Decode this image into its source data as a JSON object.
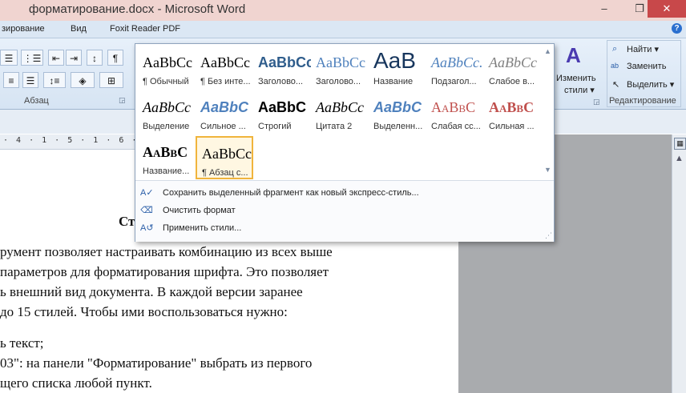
{
  "window": {
    "title": "форматирование.docx - Microsoft Word",
    "minimize_glyph": "–",
    "maximize_glyph": "❐",
    "close_glyph": "✕"
  },
  "ribbon_tabs": [
    "зирование",
    "Вид",
    "Foxit Reader PDF"
  ],
  "help_glyph": "?",
  "paragraph_group": {
    "label": "Абзац"
  },
  "styles_group": {
    "change_styles_label_1": "Изменить",
    "change_styles_label_2": "стили ▾"
  },
  "editing_group": {
    "label": "Редактирование",
    "items": [
      "Найти ▾",
      "Заменить",
      "Выделить ▾"
    ]
  },
  "ruler": {
    "numbers": "· 4 · 1 · 5 · 1 · 6 · 1 · 7 · 1 · 8 · 1 · 9 · 1 · 10"
  },
  "gallery": {
    "tiles": [
      {
        "sample": "AaBbCс",
        "name": "¶ Обычный",
        "color": "#000000",
        "style": "normal"
      },
      {
        "sample": "AaBbCс",
        "name": "¶ Без инте...",
        "color": "#000000",
        "style": "normal"
      },
      {
        "sample": "AaBbCс",
        "name": "Заголово...",
        "color": "#2f5d8c",
        "style": "bold"
      },
      {
        "sample": "AaBbCс",
        "name": "Заголово...",
        "color": "#4f81bd",
        "style": "normal"
      },
      {
        "sample": "AaB",
        "name": "Название",
        "color": "#17365d",
        "style": "big"
      },
      {
        "sample": "AaBbCc.",
        "name": "Подзагол...",
        "color": "#4f81bd",
        "style": "italic"
      },
      {
        "sample": "AaBbCс",
        "name": "Слабое в...",
        "color": "#808080",
        "style": "italic"
      },
      {
        "sample": "AaBbCс",
        "name": "Выделение",
        "color": "#000000",
        "style": "italic"
      },
      {
        "sample": "AaBbC",
        "name": "Сильное ...",
        "color": "#4f81bd",
        "style": "bolditalic"
      },
      {
        "sample": "AaBbC",
        "name": "Строгий",
        "color": "#000000",
        "style": "bold"
      },
      {
        "sample": "AaBbCс",
        "name": "Цитата 2",
        "color": "#000000",
        "style": "italic"
      },
      {
        "sample": "AaBbC",
        "name": "Выделенн...",
        "color": "#4f81bd",
        "style": "bolditalic"
      },
      {
        "sample": "AaBbC",
        "name": "Слабая сс...",
        "color": "#c0504d",
        "style": "smallcaps"
      },
      {
        "sample": "AaBbC",
        "name": "Сильная ...",
        "color": "#c0504d",
        "style": "boldsmallcaps"
      },
      {
        "sample": "AaBbC",
        "name": "Название...",
        "color": "#000000",
        "style": "boldsmallcaps"
      },
      {
        "sample": "AaBbCс",
        "name": "¶ Абзац с...",
        "color": "#000000",
        "style": "normal",
        "selected": true
      }
    ],
    "menu": [
      "Сохранить выделенный фрагмент как новый экспресс-стиль...",
      "Очистить формат",
      "Применить стили..."
    ]
  },
  "document": {
    "heading_fragment": "Ст",
    "lines": [
      "румент позволяет настраивать комбинацию из всех выше",
      "параметров для форматирования шрифта. Это позволяет",
      "ь внешний вид документа. В каждой версии заранее",
      "до 15 стилей. Чтобы ими воспользоваться нужно:",
      "ь текст;",
      "03\":  на панели \"Форматирование\" выбрать из первого",
      "щего списка любой пункт."
    ]
  }
}
